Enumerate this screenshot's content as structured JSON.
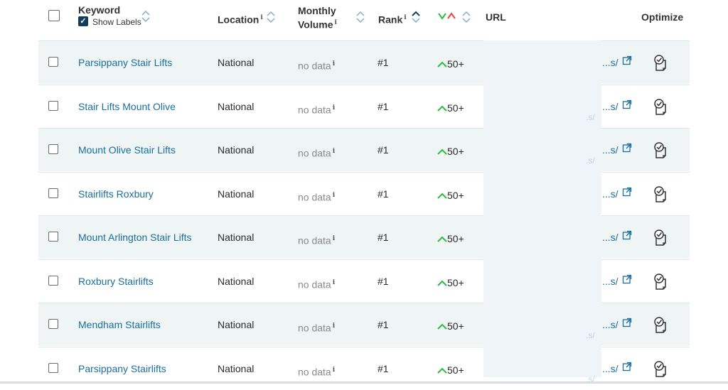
{
  "header": {
    "keyword_label": "Keyword",
    "show_labels_text": "Show Labels",
    "show_labels_checked": true,
    "location_label": "Location",
    "monthly_label_line1": "Monthly",
    "monthly_label_line2": "Volume",
    "rank_label": "Rank",
    "url_label": "URL",
    "optimize_label": "Optimize",
    "info_glyph": "i"
  },
  "colors": {
    "link": "#1a6e9e",
    "row_tint": "#eef5f4",
    "up_arrow": "#2bbd3f",
    "down_arrow": "#e84545",
    "checkbox_checked": "#133d5c"
  },
  "rows": [
    {
      "keyword": "Parsippany Stair Lifts",
      "location": "National",
      "volume": "no data",
      "rank": "#1",
      "change": "50+",
      "url": "...s/",
      "faint": ""
    },
    {
      "keyword": "Stair Lifts Mount Olive",
      "location": "National",
      "volume": "no data",
      "rank": "#1",
      "change": "50+",
      "url": "...s/",
      "faint": ".s/"
    },
    {
      "keyword": "Mount Olive Stair Lifts",
      "location": "National",
      "volume": "no data",
      "rank": "#1",
      "change": "50+",
      "url": "...s/",
      "faint": ".s/"
    },
    {
      "keyword": "Stairlifts Roxbury",
      "location": "National",
      "volume": "no data",
      "rank": "#1",
      "change": "50+",
      "url": "...s/",
      "faint": ""
    },
    {
      "keyword": "Mount Arlington Stair Lifts",
      "location": "National",
      "volume": "no data",
      "rank": "#1",
      "change": "50+",
      "url": "...s/",
      "faint": ""
    },
    {
      "keyword": "Roxbury Stairlifts",
      "location": "National",
      "volume": "no data",
      "rank": "#1",
      "change": "50+",
      "url": "...s/",
      "faint": ""
    },
    {
      "keyword": "Mendham Stairlifts",
      "location": "National",
      "volume": "no data",
      "rank": "#1",
      "change": "50+",
      "url": "...s/",
      "faint": ".s/"
    },
    {
      "keyword": "Parsippany Stairlifts",
      "location": "National",
      "volume": "no data",
      "rank": "#1",
      "change": "50+",
      "url": "...s/",
      "faint": ".s/"
    }
  ]
}
